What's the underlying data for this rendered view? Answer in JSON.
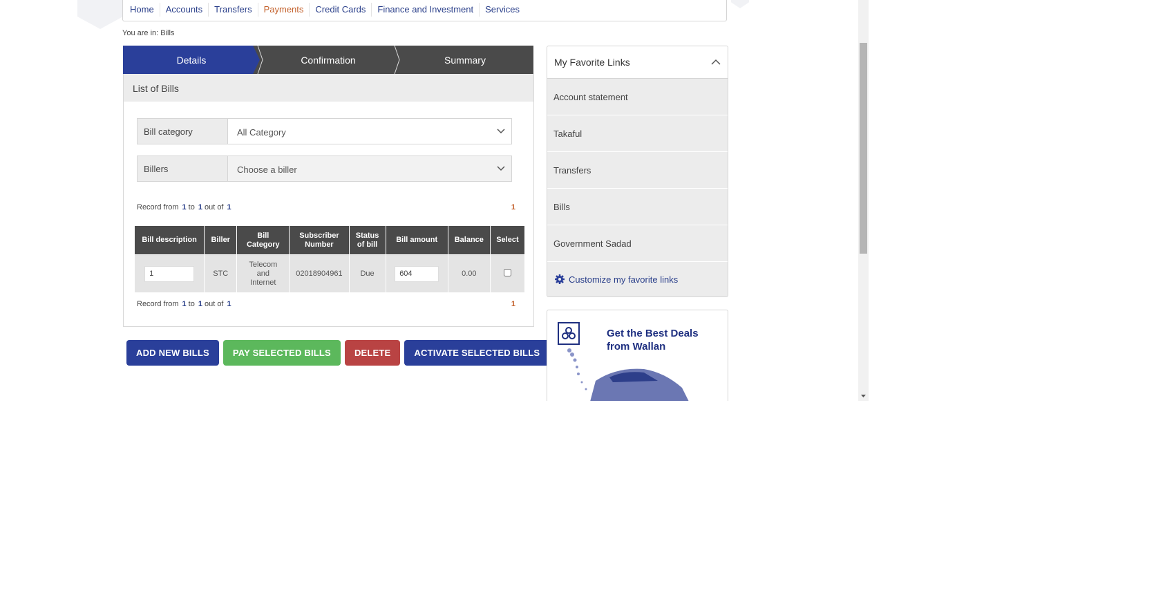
{
  "nav": {
    "items": [
      "Home",
      "Accounts",
      "Transfers",
      "Payments",
      "Credit Cards",
      "Finance and Investment",
      "Services"
    ],
    "active": "Payments"
  },
  "breadcrumb": "You are in: Bills",
  "steps": [
    "Details",
    "Confirmation",
    "Summary"
  ],
  "panel": {
    "title": "List of Bills",
    "bill_category": {
      "label": "Bill category",
      "value": "All Category"
    },
    "billers": {
      "label": "Billers",
      "placeholder": "Choose a biller"
    },
    "record": {
      "prefix": "Record from",
      "from": "1",
      "to_label": "to",
      "to": "1",
      "of_label": "out of",
      "total": "1",
      "page": "1"
    },
    "table": {
      "headers": [
        "Bill description",
        "Biller",
        "Bill Category",
        "Subscriber Number",
        "Status of bill",
        "Bill amount",
        "Balance",
        "Select"
      ],
      "rows": [
        {
          "description": "1",
          "biller": "STC",
          "category": "Telecom and Internet",
          "subscriber": "02018904961",
          "status": "Due",
          "amount": "604",
          "balance": "0.00"
        }
      ]
    }
  },
  "buttons": {
    "add": "ADD NEW BILLS",
    "pay": "PAY SELECTED BILLS",
    "delete": "DELETE",
    "activate": "ACTIVATE SELECTED BILLS"
  },
  "favorites": {
    "title": "My Favorite Links",
    "items": [
      "Account statement",
      "Takaful",
      "Transfers",
      "Bills",
      "Government Sadad"
    ],
    "customize": "Customize my favorite links"
  },
  "ad": {
    "line1": "Get the Best Deals",
    "line2": "from Wallan"
  },
  "colors": {
    "primary": "#2a3f9a",
    "accent": "#c4622d",
    "success": "#5cb85c",
    "danger": "#b94343"
  }
}
